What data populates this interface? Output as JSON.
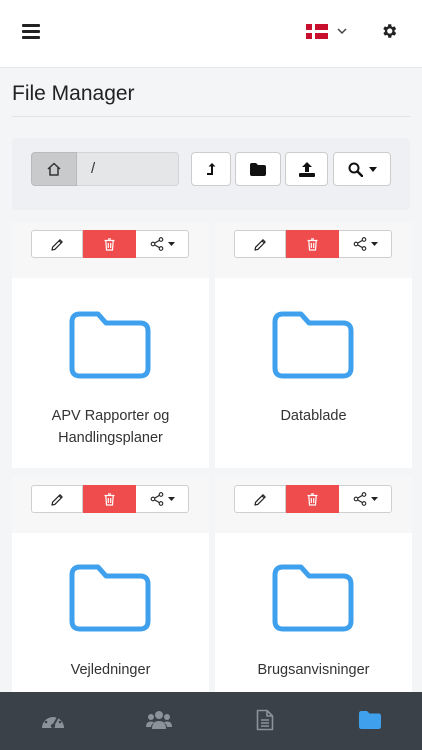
{
  "header": {
    "language": "Dansk",
    "colors": {
      "flag": "#c8102e"
    }
  },
  "page": {
    "title": "File Manager"
  },
  "toolbar": {
    "path": "/",
    "icons": [
      "home-icon",
      "level-up-icon",
      "folder-icon",
      "upload-icon",
      "search-icon",
      "caret-down-icon"
    ]
  },
  "folders": [
    {
      "name": "APV Rapporter og Handlingsplaner",
      "line1": "APV Rapporter og",
      "line2": "Handlingsplaner"
    },
    {
      "name": "Datablade",
      "line1": "Datablade",
      "line2": ""
    },
    {
      "name": "Vejledninger",
      "line1": "Vejledninger",
      "line2": ""
    },
    {
      "name": "Brugsanvisninger",
      "line1": "Brugsanvisninger",
      "line2": ""
    }
  ],
  "card_actions": [
    "pencil-icon",
    "trash-icon",
    "share-icon"
  ],
  "bottom_nav": {
    "items": [
      "dashboard-icon",
      "users-icon",
      "document-icon",
      "folder-icon"
    ],
    "active": "folder-icon"
  },
  "colors": {
    "accent": "#3fa0ee",
    "danger": "#ef4d4d",
    "nav_bg": "#3a4149",
    "nav_icon": "#8b9299"
  }
}
